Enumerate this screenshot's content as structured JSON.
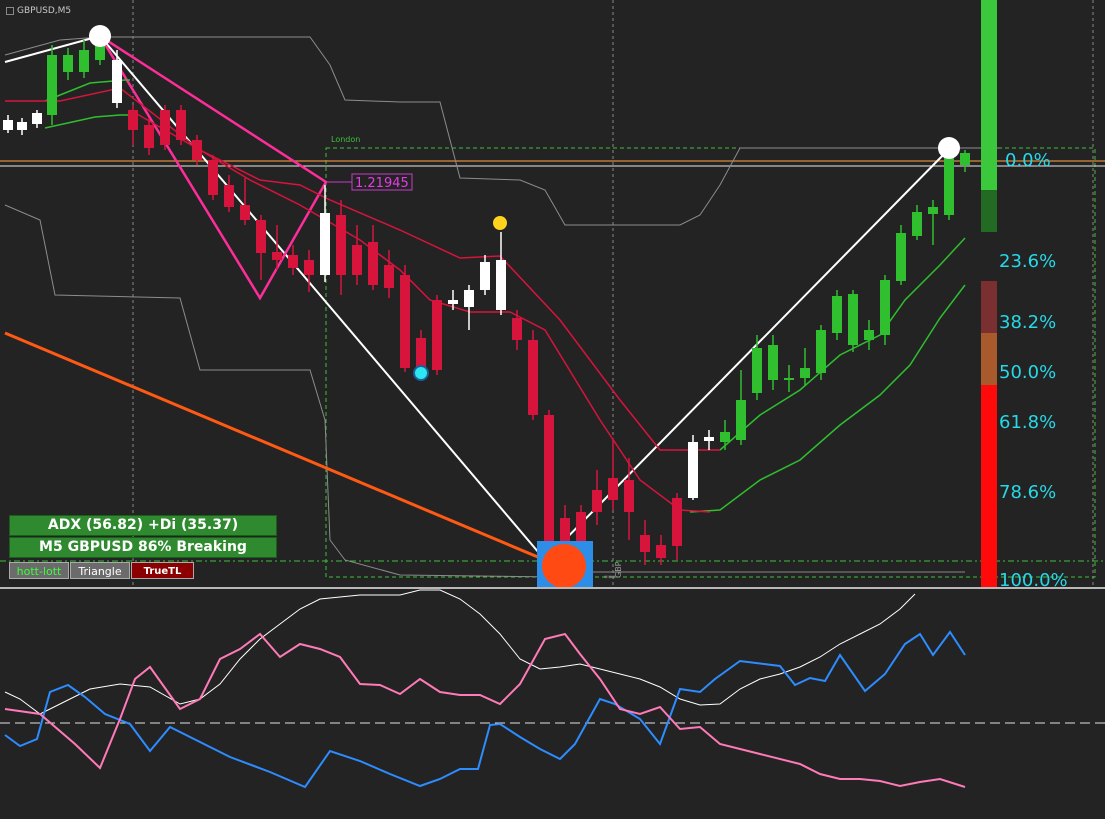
{
  "chart_title": "GBPUSD,M5",
  "session_label": "London",
  "price_tag": "1.21945",
  "fib_levels": [
    "0.0%",
    "23.6%",
    "38.2%",
    "50.0%",
    "61.8%",
    "78.6%",
    "100.0%"
  ],
  "info_panel": {
    "adx_line": "ADX (56.82)   +Di (35.37)",
    "breaking_line": "M5 GBPUSD 86% Breaking"
  },
  "buttons": {
    "hott_lott": "hott-lott",
    "triangle": "Triangle",
    "truetl": "TrueTL"
  },
  "event_marker": "GBP",
  "colors": {
    "background": "#232323",
    "bull": "#2fbf2f",
    "bear": "#d6143c",
    "neutral": "#ffffff",
    "fib_text": "#27d8e8",
    "adx_line": "#ffffff",
    "plus_di": "#2d8cff",
    "minus_di": "#ff7ab8"
  }
}
